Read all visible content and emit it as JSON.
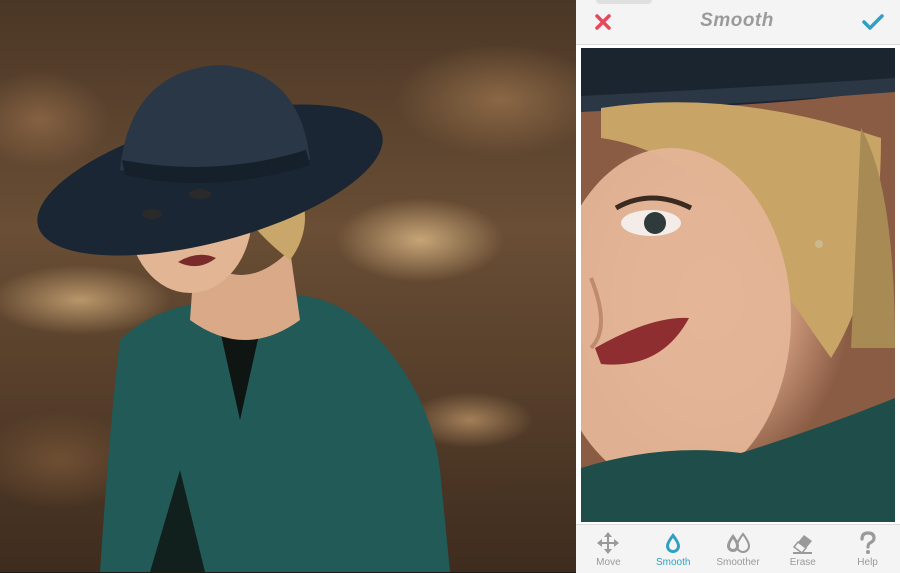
{
  "app": {
    "title": "Smooth",
    "accent": "#2f9fc4",
    "cancel_color": "#e8475a"
  },
  "toolbar": {
    "items": [
      {
        "label": "Move",
        "icon": "move-icon"
      },
      {
        "label": "Smooth",
        "icon": "drop-icon",
        "active": true
      },
      {
        "label": "Smoother",
        "icon": "double-drop-icon"
      },
      {
        "label": "Erase",
        "icon": "eraser-icon"
      },
      {
        "label": "Help",
        "icon": "question-icon"
      }
    ]
  }
}
